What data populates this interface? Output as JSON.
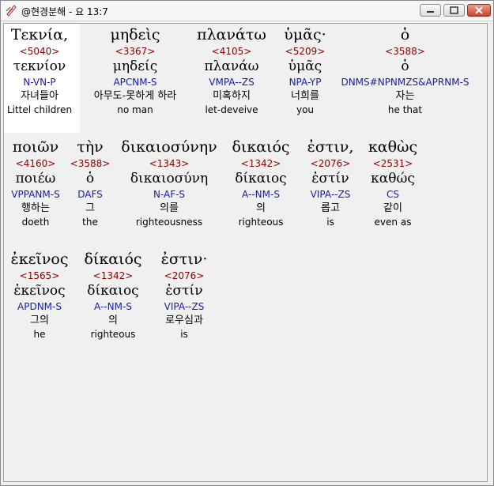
{
  "window": {
    "title": "@현경분해 - 요 13:7"
  },
  "icons": {
    "app": "app-icon",
    "minimize": "minimize-icon",
    "maximize": "maximize-icon",
    "close": "close-icon"
  },
  "rows": [
    [
      {
        "greek": "Τεκνία,",
        "num": "<5040>",
        "lemma": "τεκνίον",
        "parse": "N-VN-P",
        "korean": "자녀들아",
        "english": "Littel children"
      },
      {
        "greek": "μηδεὶς",
        "num": "<3367>",
        "lemma": "μηδείς",
        "parse": "APCNM-S",
        "korean": "아무도-못하게 하라",
        "english": "no man"
      },
      {
        "greek": "πλανάτω",
        "num": "<4105>",
        "lemma": "πλανάω",
        "parse": "VMPA--ZS",
        "korean": "미혹하지",
        "english": "let-deveive"
      },
      {
        "greek": "ὑμᾶς·",
        "num": "<5209>",
        "lemma": "ὑμᾶς",
        "parse": "NPA-YP",
        "korean": "너희를",
        "english": "you"
      },
      {
        "greek": "ὁ",
        "num": "<3588>",
        "lemma": "ὁ",
        "parse": "DNMS#NPNMZS&APRNM-S",
        "korean": "자는",
        "english": "he that"
      }
    ],
    [
      {
        "greek": "ποιῶν",
        "num": "<4160>",
        "lemma": "ποιέω",
        "parse": "VPPANM-S",
        "korean": "행하는",
        "english": "doeth"
      },
      {
        "greek": "τὴν",
        "num": "<3588>",
        "lemma": "ὁ",
        "parse": "DAFS",
        "korean": "그",
        "english": "the"
      },
      {
        "greek": "δικαιοσύνην",
        "num": "<1343>",
        "lemma": "δικαιοσύνη",
        "parse": "N-AF-S",
        "korean": "의를",
        "english": "righteousness"
      },
      {
        "greek": "δικαιός",
        "num": "<1342>",
        "lemma": "δίκαιος",
        "parse": "A--NM-S",
        "korean": "의",
        "english": "righteous"
      },
      {
        "greek": "ἐστιν,",
        "num": "<2076>",
        "lemma": "ἐστίν",
        "parse": "VIPA--ZS",
        "korean": "롭고",
        "english": "is"
      },
      {
        "greek": "καθὼς",
        "num": "<2531>",
        "lemma": "καθώς",
        "parse": "CS",
        "korean": "같이",
        "english": "even as"
      }
    ],
    [
      {
        "greek": "ἐκεῖνος",
        "num": "<1565>",
        "lemma": "ἐκεῖνος",
        "parse": "APDNM-S",
        "korean": "그의",
        "english": "he"
      },
      {
        "greek": "δίκαιός",
        "num": "<1342>",
        "lemma": "δίκαιος",
        "parse": "A--NM-S",
        "korean": "의",
        "english": "righteous"
      },
      {
        "greek": "ἐστιν·",
        "num": "<2076>",
        "lemma": "ἐστίν",
        "parse": "VIPA--ZS",
        "korean": "로우심과",
        "english": "is"
      }
    ]
  ]
}
